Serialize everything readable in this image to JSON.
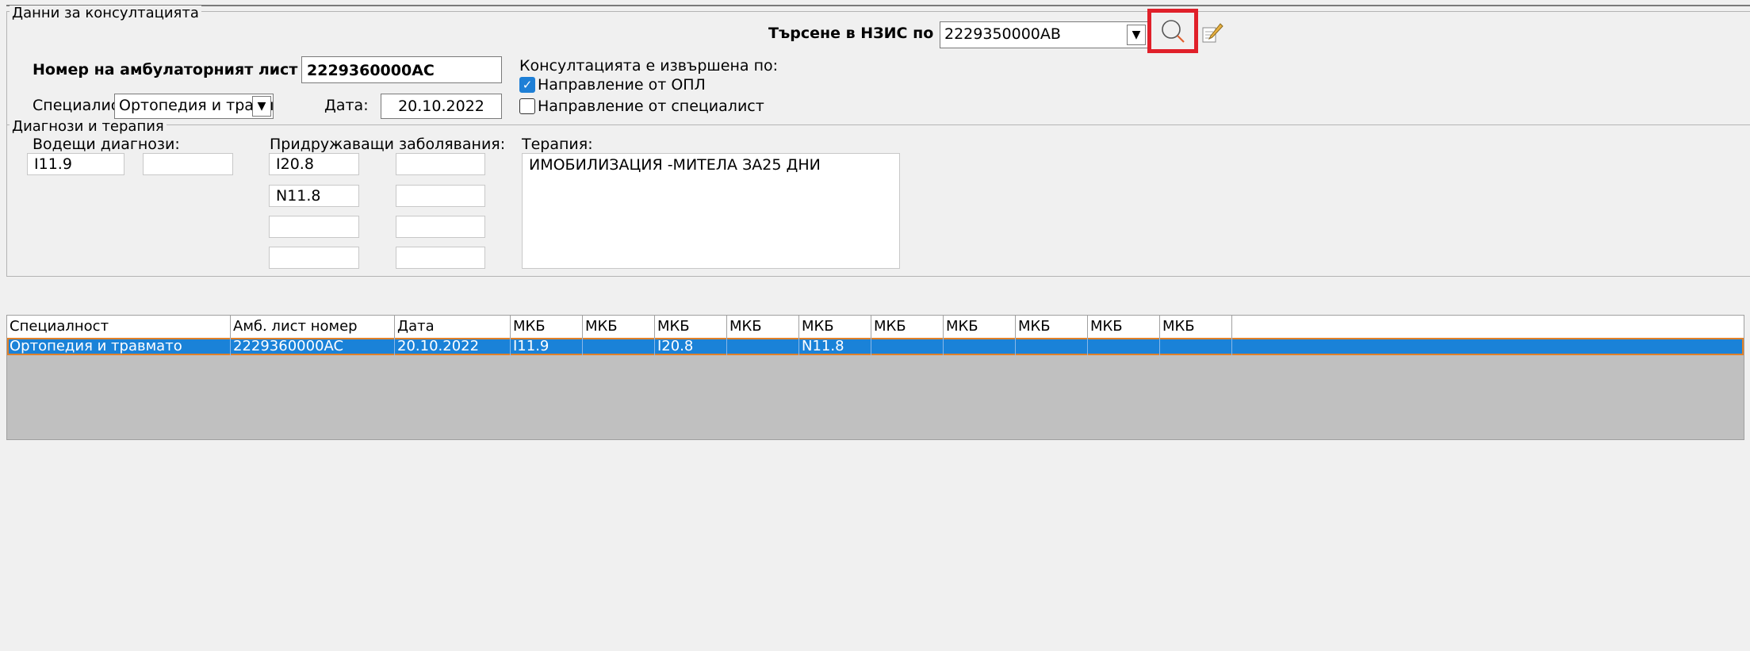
{
  "consultation": {
    "group_title": "Данни за консултацията",
    "search_label": "Търсене в НЗИС по НРН",
    "search_value": "2229350000AB",
    "sheet_label": "Номер на амбулаторният лист / НРН :",
    "sheet_value": "2229360000AC",
    "performed_by_label": "Консултацията е извършена по:",
    "referral_gp_label": "Направление от ОПЛ",
    "referral_gp_checked": true,
    "referral_spec_label": "Направление от специалист",
    "referral_spec_checked": false,
    "specialist_label": "Специалист:",
    "specialist_value": "Ортопедия и травматол",
    "date_label": "Дата:",
    "date_value": "20.10.2022"
  },
  "diagnoses": {
    "group_title": "Диагнози и терапия",
    "leading_label": "Водещи диагнози:",
    "leading": [
      "I11.9",
      ""
    ],
    "concomitant_label": "Придружаващи заболявания:",
    "concomitant": [
      "I20.8",
      "",
      "N11.8",
      "",
      "",
      "",
      "",
      ""
    ],
    "therapy_label": "Терапия:",
    "therapy_value": "ИМОБИЛИЗАЦИЯ -МИТЕЛА ЗА25 ДНИ"
  },
  "table": {
    "columns": [
      "Специалност",
      "Амб. лист номер",
      "Дата",
      "МКБ",
      "МКБ",
      "МКБ",
      "МКБ",
      "МКБ",
      "МКБ",
      "МКБ",
      "МКБ",
      "МКБ",
      "МКБ"
    ],
    "rows": [
      [
        "Ортопедия и травмато",
        "2229360000AC",
        "20.10.2022",
        "I11.9",
        "",
        "I20.8",
        "",
        "N11.8",
        "",
        "",
        "",
        "",
        ""
      ]
    ]
  },
  "icons": {
    "search": "magnifier-icon",
    "edit": "pencil-icon",
    "highlight_color": "#e0202a",
    "selection_color": "#1a82d8"
  }
}
